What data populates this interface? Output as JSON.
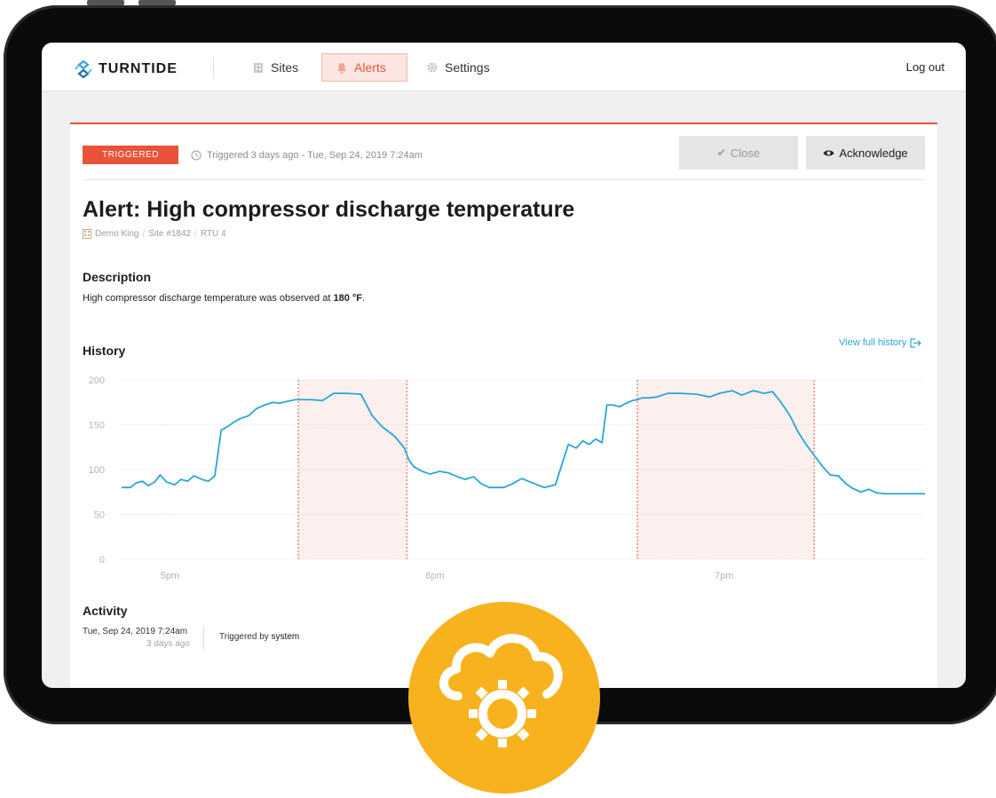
{
  "nav": {
    "logo_text": "TURNTIDE",
    "items": [
      {
        "label": "Sites",
        "icon": "building-icon",
        "active": false
      },
      {
        "label": "Alerts",
        "icon": "bell-icon",
        "active": true
      },
      {
        "label": "Settings",
        "icon": "gear-icon",
        "active": false
      }
    ],
    "logout": "Log out"
  },
  "alert": {
    "badge": "TRIGGERED",
    "triggered_text": "Triggered 3 days ago - Tue, Sep 24, 2019 7:24am",
    "close_label": "Close",
    "ack_label": "Acknowledge",
    "title": "Alert: High compressor discharge temperature",
    "breadcrumb": [
      "Demo King",
      "Site #1842",
      "RTU 4"
    ]
  },
  "description": {
    "heading": "Description",
    "text_prefix": "High compressor discharge temperature was observed at ",
    "value": "180 °F",
    "text_suffix": "."
  },
  "history": {
    "heading": "History",
    "view_full": "View full history"
  },
  "chart_data": {
    "type": "line",
    "yticks": [
      0,
      50,
      100,
      150,
      200
    ],
    "ylim": [
      0,
      200
    ],
    "xticks": [
      "5pm",
      "6pm",
      "7pm"
    ],
    "grid": true,
    "line_color": "#2aa6d6",
    "highlight_color": "#e8533a",
    "highlight_ranges": [
      [
        0.22,
        0.355
      ],
      [
        0.642,
        0.862
      ]
    ],
    "x": [
      0,
      0.011,
      0.018,
      0.026,
      0.033,
      0.041,
      0.048,
      0.056,
      0.066,
      0.074,
      0.082,
      0.09,
      0.1,
      0.108,
      0.116,
      0.124,
      0.132,
      0.14,
      0.148,
      0.158,
      0.168,
      0.178,
      0.188,
      0.196,
      0.206,
      0.216,
      0.226,
      0.236,
      0.25,
      0.264,
      0.28,
      0.298,
      0.312,
      0.324,
      0.34,
      0.352,
      0.358,
      0.364,
      0.374,
      0.384,
      0.396,
      0.408,
      0.418,
      0.428,
      0.438,
      0.448,
      0.458,
      0.468,
      0.476,
      0.486,
      0.498,
      0.512,
      0.526,
      0.54,
      0.556,
      0.566,
      0.574,
      0.582,
      0.59,
      0.598,
      0.604,
      0.612,
      0.62,
      0.628,
      0.636,
      0.642,
      0.648,
      0.658,
      0.666,
      0.68,
      0.696,
      0.716,
      0.732,
      0.744,
      0.76,
      0.772,
      0.786,
      0.8,
      0.81,
      0.82,
      0.832,
      0.842,
      0.852,
      0.862,
      0.872,
      0.882,
      0.892,
      0.902,
      0.91,
      0.92,
      0.93,
      0.94,
      0.95,
      0.96,
      0.97,
      0.982,
      1.0
    ],
    "values": [
      80,
      80,
      85,
      87,
      82,
      86,
      94,
      86,
      83,
      89,
      87,
      93,
      89,
      87,
      93,
      144,
      148,
      153,
      157,
      160,
      168,
      172,
      175,
      174,
      176,
      178,
      178,
      178,
      177,
      185,
      185,
      184,
      160,
      148,
      137,
      124,
      110,
      103,
      98,
      95,
      98,
      96,
      92,
      89,
      92,
      84,
      80,
      80,
      80,
      84,
      90,
      85,
      80,
      83,
      128,
      124,
      132,
      128,
      134,
      130,
      172,
      172,
      170,
      174,
      177,
      178,
      180,
      180,
      181,
      185,
      185,
      184,
      181,
      185,
      188,
      183,
      188,
      185,
      187,
      176,
      160,
      142,
      128,
      116,
      104,
      94,
      93,
      84,
      79,
      75,
      78,
      74,
      73,
      73,
      73,
      73,
      73
    ]
  },
  "activity": {
    "heading": "Activity",
    "date": "Tue, Sep 24, 2019 7:24am",
    "ago": "3 days ago",
    "text_prefix": "Triggered by ",
    "actor": "system"
  }
}
